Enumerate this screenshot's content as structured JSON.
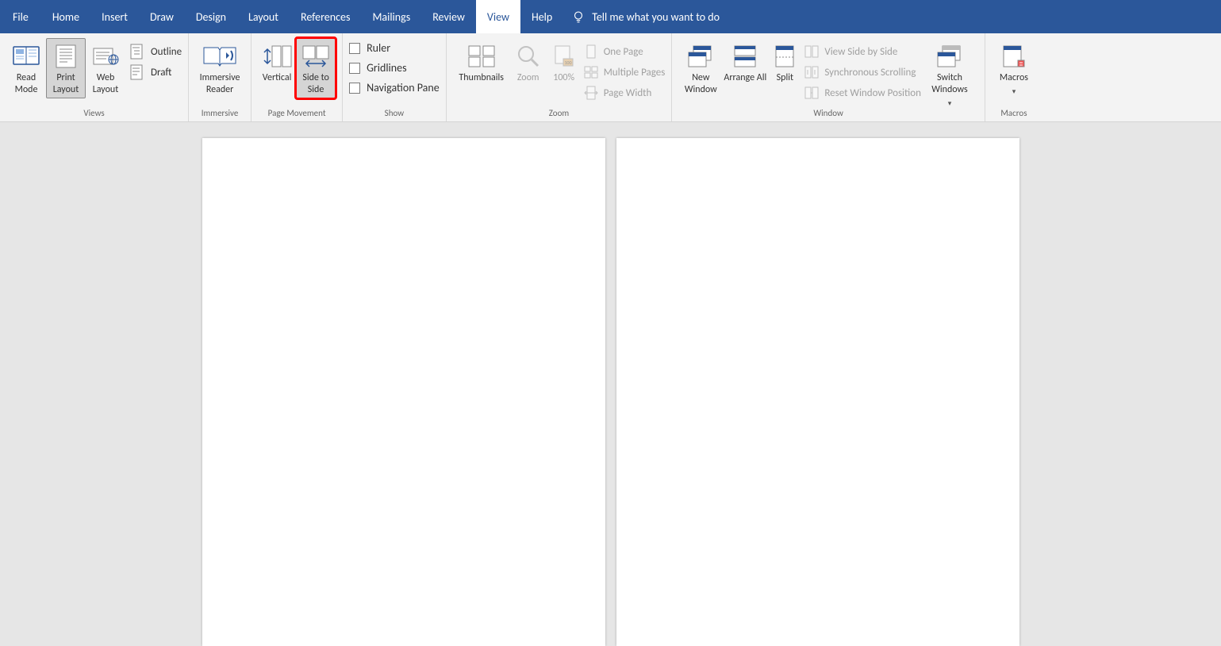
{
  "tabs": {
    "file": "File",
    "home": "Home",
    "insert": "Insert",
    "draw": "Draw",
    "design": "Design",
    "layout": "Layout",
    "references": "References",
    "mailings": "Mailings",
    "review": "Review",
    "view": "View",
    "help": "Help",
    "tellme": "Tell me what you want to do"
  },
  "groups": {
    "views": {
      "label": "Views",
      "read_mode": "Read Mode",
      "print_layout": "Print Layout",
      "web_layout": "Web Layout",
      "outline": "Outline",
      "draft": "Draft"
    },
    "immersive": {
      "label": "Immersive",
      "reader": "Immersive Reader"
    },
    "page_movement": {
      "label": "Page Movement",
      "vertical": "Vertical",
      "side_to_side": "Side to Side"
    },
    "show": {
      "label": "Show",
      "ruler": "Ruler",
      "gridlines": "Gridlines",
      "navpane": "Navigation Pane"
    },
    "zoom_group": {
      "label": "Zoom",
      "thumbnails": "Thumbnails",
      "zoom": "Zoom",
      "hundred": "100%",
      "one_page": "One Page",
      "multi_pages": "Multiple Pages",
      "page_width": "Page Width"
    },
    "window": {
      "label": "Window",
      "new_window": "New Window",
      "arrange_all": "Arrange All",
      "split": "Split",
      "side_by_side": "View Side by Side",
      "sync_scroll": "Synchronous Scrolling",
      "reset_pos": "Reset Window Position",
      "switch": "Switch Windows"
    },
    "macros": {
      "label": "Macros",
      "macros": "Macros"
    }
  }
}
